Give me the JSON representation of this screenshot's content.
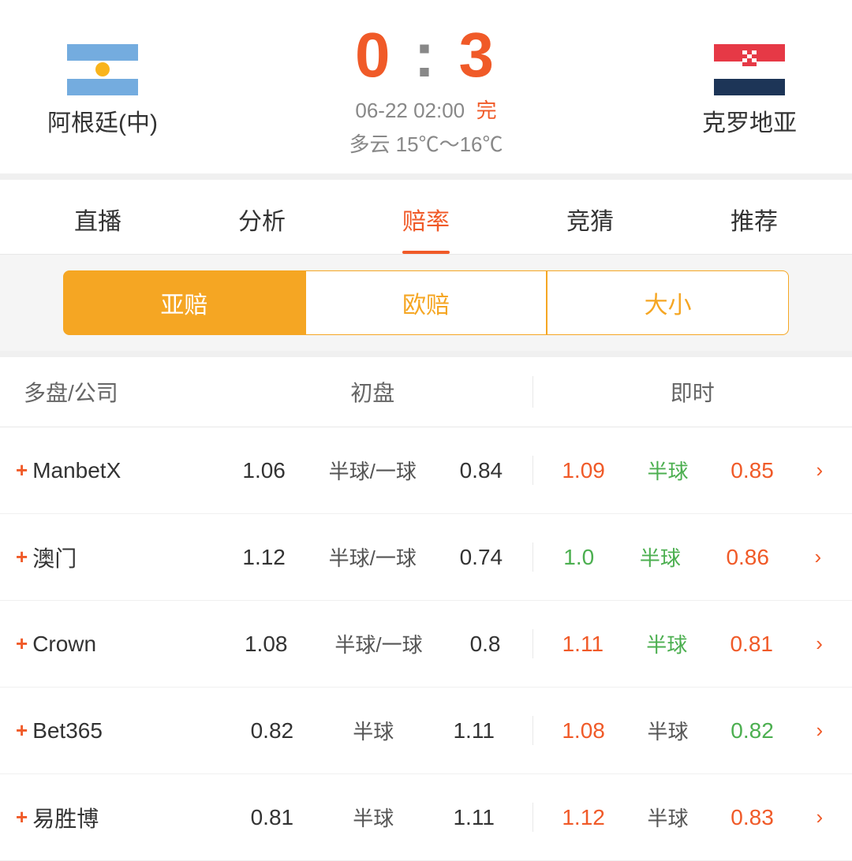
{
  "header": {
    "team_home": "阿根廷(中)",
    "team_away": "克罗地亚",
    "score_home": "0",
    "score_colon": ":",
    "score_away": "3",
    "datetime": "06-22 02:00",
    "status": "完",
    "weather": "多云  15℃～16℃"
  },
  "tabs": [
    {
      "label": "直播",
      "active": false
    },
    {
      "label": "分析",
      "active": false
    },
    {
      "label": "赔率",
      "active": true
    },
    {
      "label": "竞猜",
      "active": false
    },
    {
      "label": "推荐",
      "active": false
    }
  ],
  "sub_tabs": [
    {
      "label": "亚赔",
      "active": true
    },
    {
      "label": "欧赔",
      "active": false
    },
    {
      "label": "大小",
      "active": false
    }
  ],
  "table": {
    "col_company": "多盘/公司",
    "col_initial": "初盘",
    "col_realtime": "即时",
    "rows": [
      {
        "company": "ManbetX",
        "init_home": "1.06",
        "init_handicap": "半球/一球",
        "init_away": "0.84",
        "rt_home": "1.09",
        "rt_home_color": "orange",
        "rt_handicap": "半球",
        "rt_handicap_color": "green",
        "rt_away": "0.85",
        "rt_away_color": "orange"
      },
      {
        "company": "澳门",
        "init_home": "1.12",
        "init_handicap": "半球/一球",
        "init_away": "0.74",
        "rt_home": "1.0",
        "rt_home_color": "green",
        "rt_handicap": "半球",
        "rt_handicap_color": "green",
        "rt_away": "0.86",
        "rt_away_color": "orange"
      },
      {
        "company": "Crown",
        "init_home": "1.08",
        "init_handicap": "半球/一球",
        "init_away": "0.8",
        "rt_home": "1.11",
        "rt_home_color": "orange",
        "rt_handicap": "半球",
        "rt_handicap_color": "green",
        "rt_away": "0.81",
        "rt_away_color": "orange"
      },
      {
        "company": "Bet365",
        "init_home": "0.82",
        "init_handicap": "半球",
        "init_away": "1.11",
        "rt_home": "1.08",
        "rt_home_color": "orange",
        "rt_handicap": "半球",
        "rt_handicap_color": "normal",
        "rt_away": "0.82",
        "rt_away_color": "green"
      },
      {
        "company": "易胜博",
        "init_home": "0.81",
        "init_handicap": "半球",
        "init_away": "1.11",
        "rt_home": "1.12",
        "rt_home_color": "orange",
        "rt_handicap": "半球",
        "rt_handicap_color": "normal",
        "rt_away": "0.83",
        "rt_away_color": "orange"
      }
    ]
  }
}
